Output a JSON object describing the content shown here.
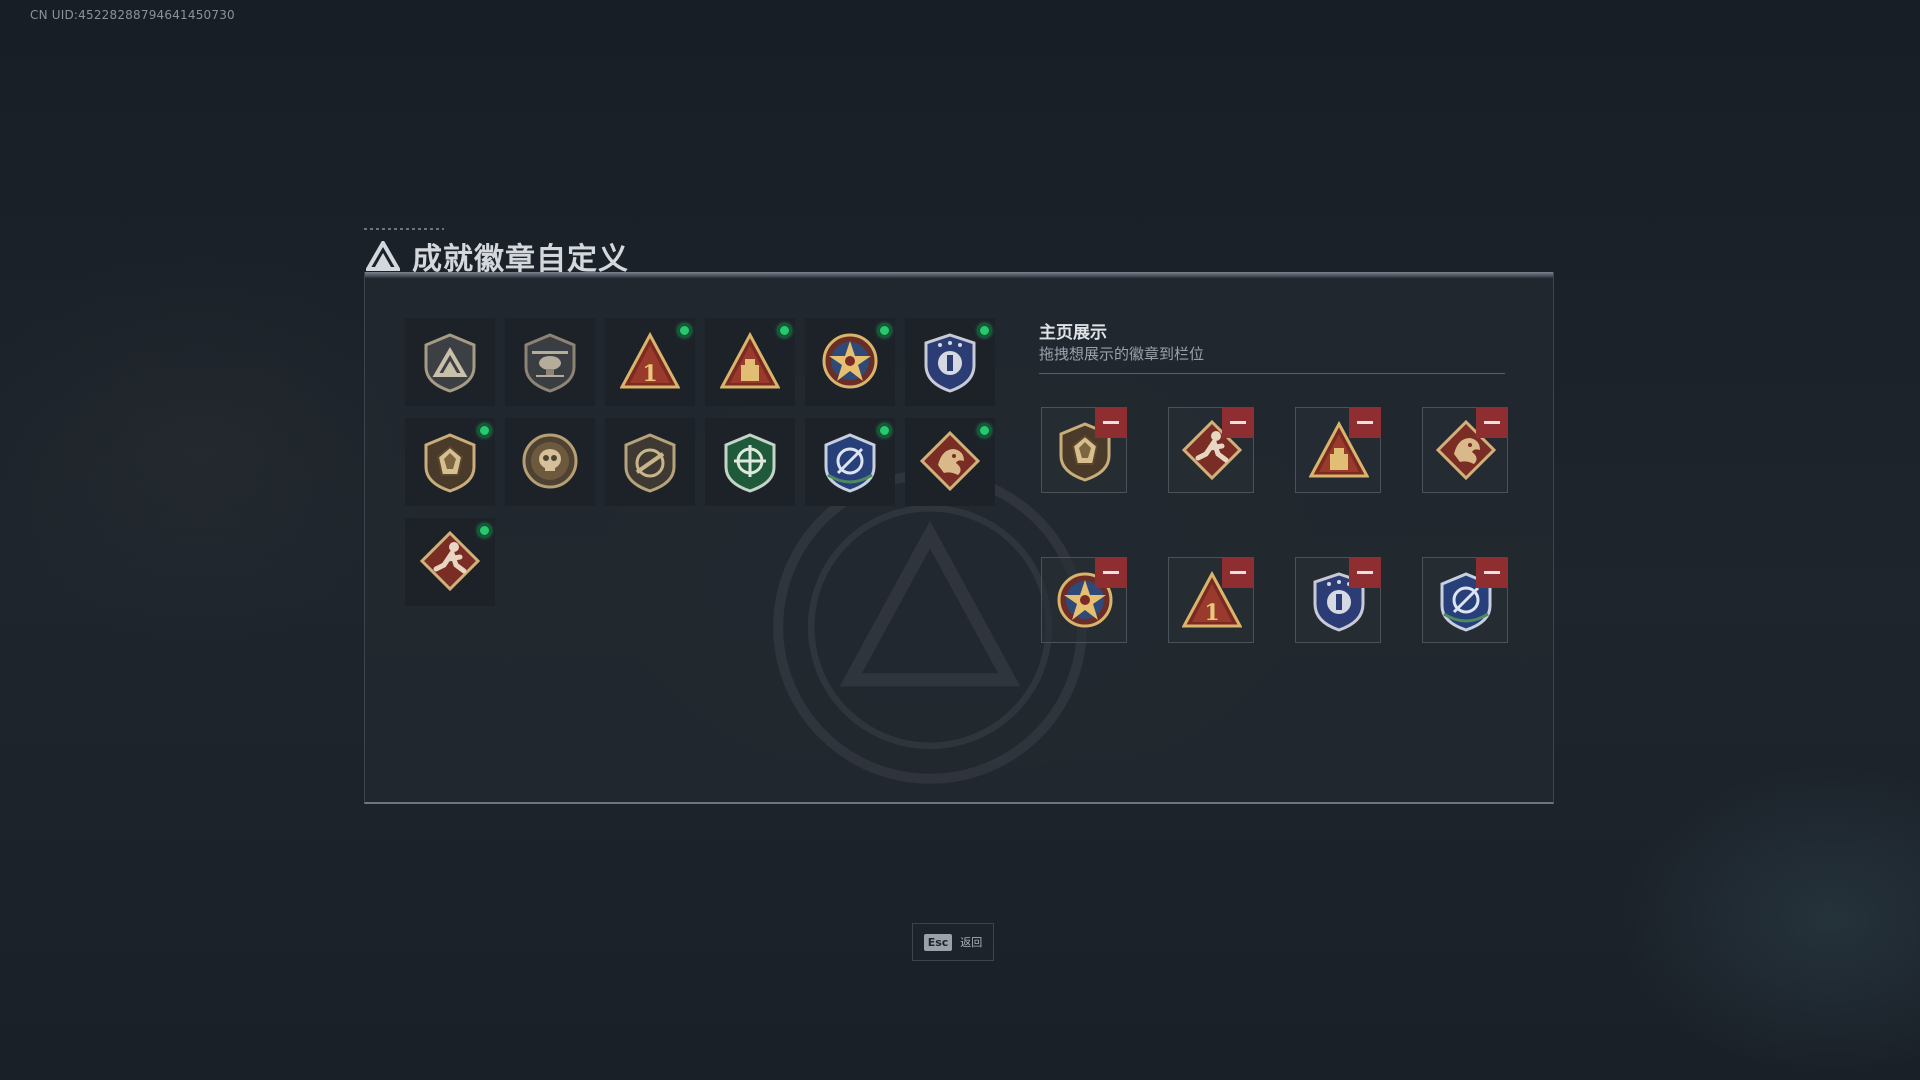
{
  "uid_text": "CN UID:45228288794641450730",
  "title": "成就徽章自定义",
  "showcase": {
    "title": "主页展示",
    "subtitle": "拖拽想展示的徽章到栏位"
  },
  "collection": [
    {
      "name": "delta-triangle-shield",
      "new": false
    },
    {
      "name": "helicopter",
      "new": false
    },
    {
      "name": "rank-one-triangle",
      "new": true
    },
    {
      "name": "supply-crate-triangle",
      "new": true
    },
    {
      "name": "gold-star-emblem",
      "new": true
    },
    {
      "name": "blue-crest-shield",
      "new": true
    },
    {
      "name": "gem-shield",
      "new": true
    },
    {
      "name": "skull-medallion",
      "new": false
    },
    {
      "name": "rifle-shield",
      "new": false
    },
    {
      "name": "green-target-shield",
      "new": false
    },
    {
      "name": "blue-target-shield",
      "new": true
    },
    {
      "name": "dragon-diamond",
      "new": true
    },
    {
      "name": "runner-diamond",
      "new": true
    }
  ],
  "display_slots": [
    {
      "name": "gem-shield"
    },
    {
      "name": "runner-diamond"
    },
    {
      "name": "supply-crate-triangle"
    },
    {
      "name": "dragon-diamond"
    },
    {
      "name": "gold-star-emblem"
    },
    {
      "name": "rank-one-triangle"
    },
    {
      "name": "blue-crest-shield"
    },
    {
      "name": "blue-target-shield"
    }
  ],
  "footer": {
    "esc_key": "Esc",
    "esc_label": "返回"
  },
  "colors": {
    "new_indicator": "#27c96d",
    "remove_button": "#8e2e31",
    "panel_bg": "#22282f"
  }
}
